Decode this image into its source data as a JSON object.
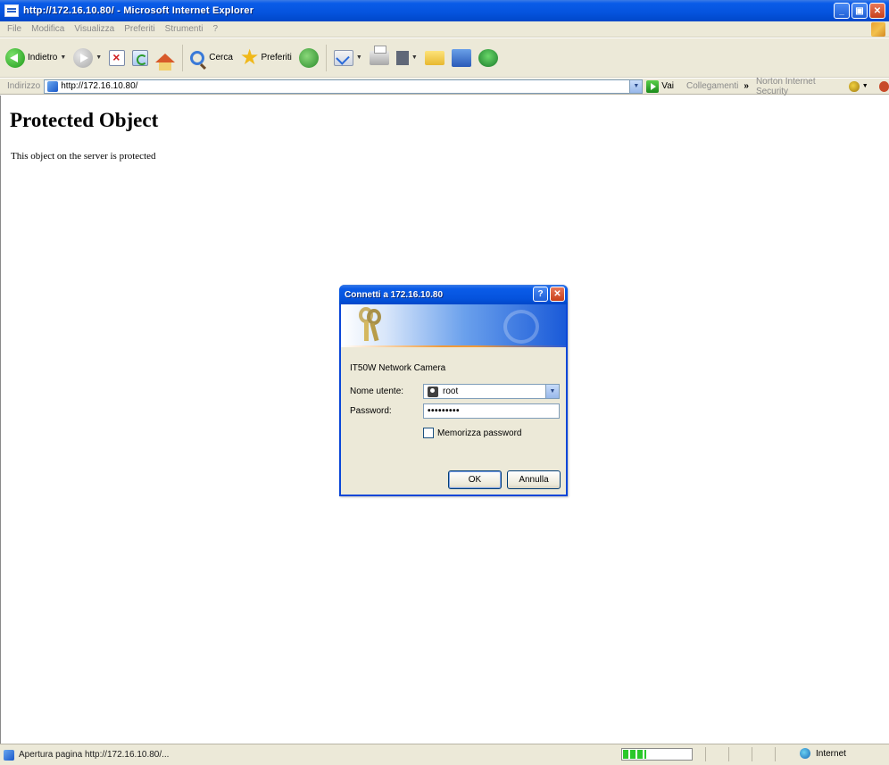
{
  "window": {
    "title": "http://172.16.10.80/ - Microsoft Internet Explorer"
  },
  "menu": {
    "items": [
      "File",
      "Modifica",
      "Visualizza",
      "Preferiti",
      "Strumenti",
      "?"
    ]
  },
  "toolbar": {
    "back_label": "Indietro",
    "search_label": "Cerca",
    "favorites_label": "Preferiti"
  },
  "address": {
    "label": "Indirizzo",
    "url": "http://172.16.10.80/",
    "go_label": "Vai",
    "links_label": "Collegamenti",
    "norton_label": "Norton Internet Security"
  },
  "page": {
    "heading": "Protected Object",
    "message": "This object on the server is protected"
  },
  "dialog": {
    "title": "Connetti a 172.16.10.80",
    "device": "IT50W Network Camera",
    "username_label": "Nome utente:",
    "username_value": "root",
    "password_label": "Password:",
    "password_value": "•••••••••",
    "remember_label": "Memorizza password",
    "ok_label": "OK",
    "cancel_label": "Annulla"
  },
  "status": {
    "text": "Apertura pagina http://172.16.10.80/...",
    "zone": "Internet"
  }
}
